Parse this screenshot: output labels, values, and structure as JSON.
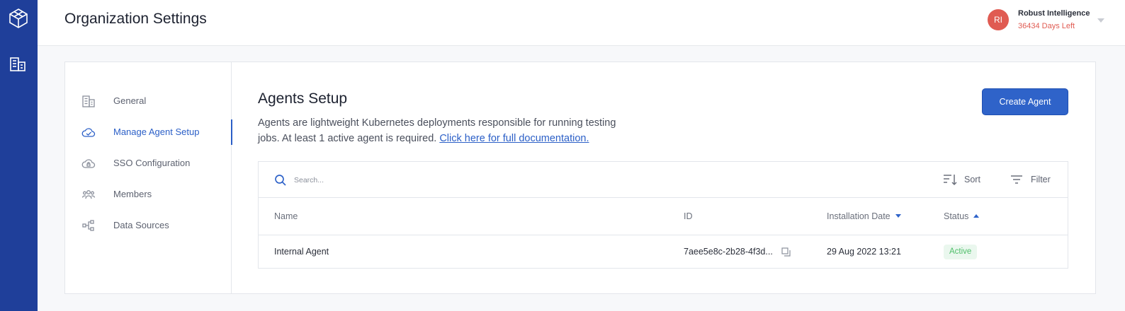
{
  "header": {
    "title": "Organization Settings",
    "user": {
      "initials": "RI",
      "name": "Robust Intelligence",
      "days_left": "36434 Days Left"
    }
  },
  "rail": {
    "logo_icon": "cube-logo-icon",
    "items": [
      {
        "icon": "building-icon"
      }
    ]
  },
  "sidebar": {
    "items": [
      {
        "label": "General",
        "icon": "building-icon",
        "active": false
      },
      {
        "label": "Manage Agent Setup",
        "icon": "cloud-check-icon",
        "active": true
      },
      {
        "label": "SSO Configuration",
        "icon": "cloud-lock-icon",
        "active": false
      },
      {
        "label": "Members",
        "icon": "people-icon",
        "active": false
      },
      {
        "label": "Data Sources",
        "icon": "nodes-icon",
        "active": false
      }
    ]
  },
  "main": {
    "title": "Agents Setup",
    "description": "Agents are lightweight Kubernetes deployments responsible for running testing jobs. At least 1 active agent is required.",
    "doc_link": "Click here for full documentation.",
    "create_button": "Create Agent"
  },
  "table": {
    "search_placeholder": "Search...",
    "sort_label": "Sort",
    "filter_label": "Filter",
    "columns": [
      "Name",
      "ID",
      "Installation Date",
      "Status"
    ],
    "rows": [
      {
        "name": "Internal Agent",
        "id": "7aee5e8c-2b28-4f3d...",
        "installation_date": "29 Aug 2022 13:21",
        "status": "Active"
      }
    ]
  },
  "colors": {
    "rail": "#1f3f9a",
    "accent": "#2f63c9",
    "avatar": "#e05b52",
    "active_badge_bg": "#eaf7ee",
    "active_badge_text": "#4fbf6a"
  }
}
